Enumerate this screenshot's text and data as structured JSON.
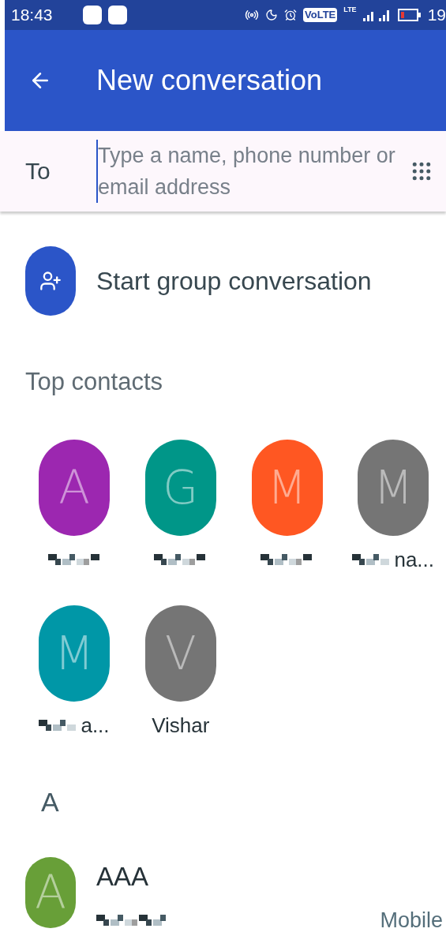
{
  "status_bar": {
    "time": "18:43",
    "volte": "VoLTE",
    "lte": "LTE",
    "battery": "19"
  },
  "header": {
    "title": "New conversation"
  },
  "to_field": {
    "label": "To",
    "placeholder": "Type a name, phone number or email address"
  },
  "group_action": {
    "label": "Start group conversation"
  },
  "top_contacts": {
    "title": "Top contacts",
    "contacts": [
      {
        "initial": "A",
        "color": "#9c27b0",
        "redacted": true
      },
      {
        "initial": "G",
        "color": "#009688",
        "redacted": true
      },
      {
        "initial": "M",
        "color": "#ff5722",
        "redacted": true
      },
      {
        "initial": "M",
        "color": "#757575",
        "redacted": true,
        "name": "na..."
      },
      {
        "initial": "M",
        "color": "#0097a7",
        "redacted": true,
        "name": "a..."
      },
      {
        "initial": "V",
        "color": "#757575",
        "redacted": false,
        "name": "Vishar"
      }
    ]
  },
  "sections": [
    {
      "letter": "A",
      "contacts": [
        {
          "initial": "A",
          "color": "#689f38",
          "name": "AAA",
          "number_redacted": true,
          "type": "Mobile"
        }
      ]
    }
  ]
}
